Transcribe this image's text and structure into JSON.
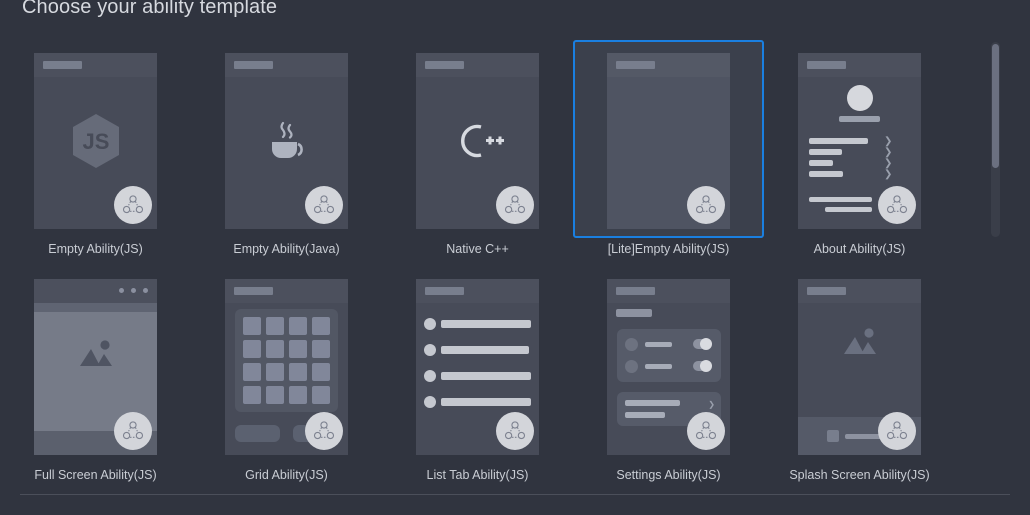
{
  "page_title": "Choose your ability template",
  "colors": {
    "background": "#30343f",
    "card_surface": "#474b58",
    "selection_border": "#1a7fe0",
    "label_text": "#c9cdd4",
    "title_text": "#d6d9df",
    "badge_fill": "#d3d5da",
    "scrollbar_thumb": "#6b7080"
  },
  "templates": [
    {
      "label": "Empty Ability(JS)",
      "icon": "js-hexagon-icon",
      "kind": "empty-js",
      "selected": false
    },
    {
      "label": "Empty Ability(Java)",
      "icon": "java-coffee-cup-icon",
      "kind": "empty-java",
      "selected": false
    },
    {
      "label": "Native C++",
      "icon": "cpp-logo-icon",
      "kind": "native-cpp",
      "selected": false
    },
    {
      "label": "[Lite]Empty Ability(JS)",
      "icon": "blank-screen-icon",
      "kind": "lite-empty-js",
      "selected": true
    },
    {
      "label": "About Ability(JS)",
      "icon": "about-page-icon",
      "kind": "about",
      "selected": false
    },
    {
      "label": "Full Screen Ability(JS)",
      "icon": "image-placeholder-icon",
      "kind": "full-screen",
      "selected": false
    },
    {
      "label": "Grid Ability(JS)",
      "icon": "grid-layout-icon",
      "kind": "grid",
      "selected": false
    },
    {
      "label": "List Tab Ability(JS)",
      "icon": "list-rows-icon",
      "kind": "list-tab",
      "selected": false
    },
    {
      "label": "Settings Ability(JS)",
      "icon": "settings-toggles-icon",
      "kind": "settings",
      "selected": false
    },
    {
      "label": "Splash Screen Ability(JS)",
      "icon": "image-placeholder-icon",
      "kind": "splash",
      "selected": false
    }
  ],
  "badge": {
    "name": "harmonyos-badge-icon"
  },
  "scrollbar": {
    "name": "vertical-scrollbar"
  }
}
